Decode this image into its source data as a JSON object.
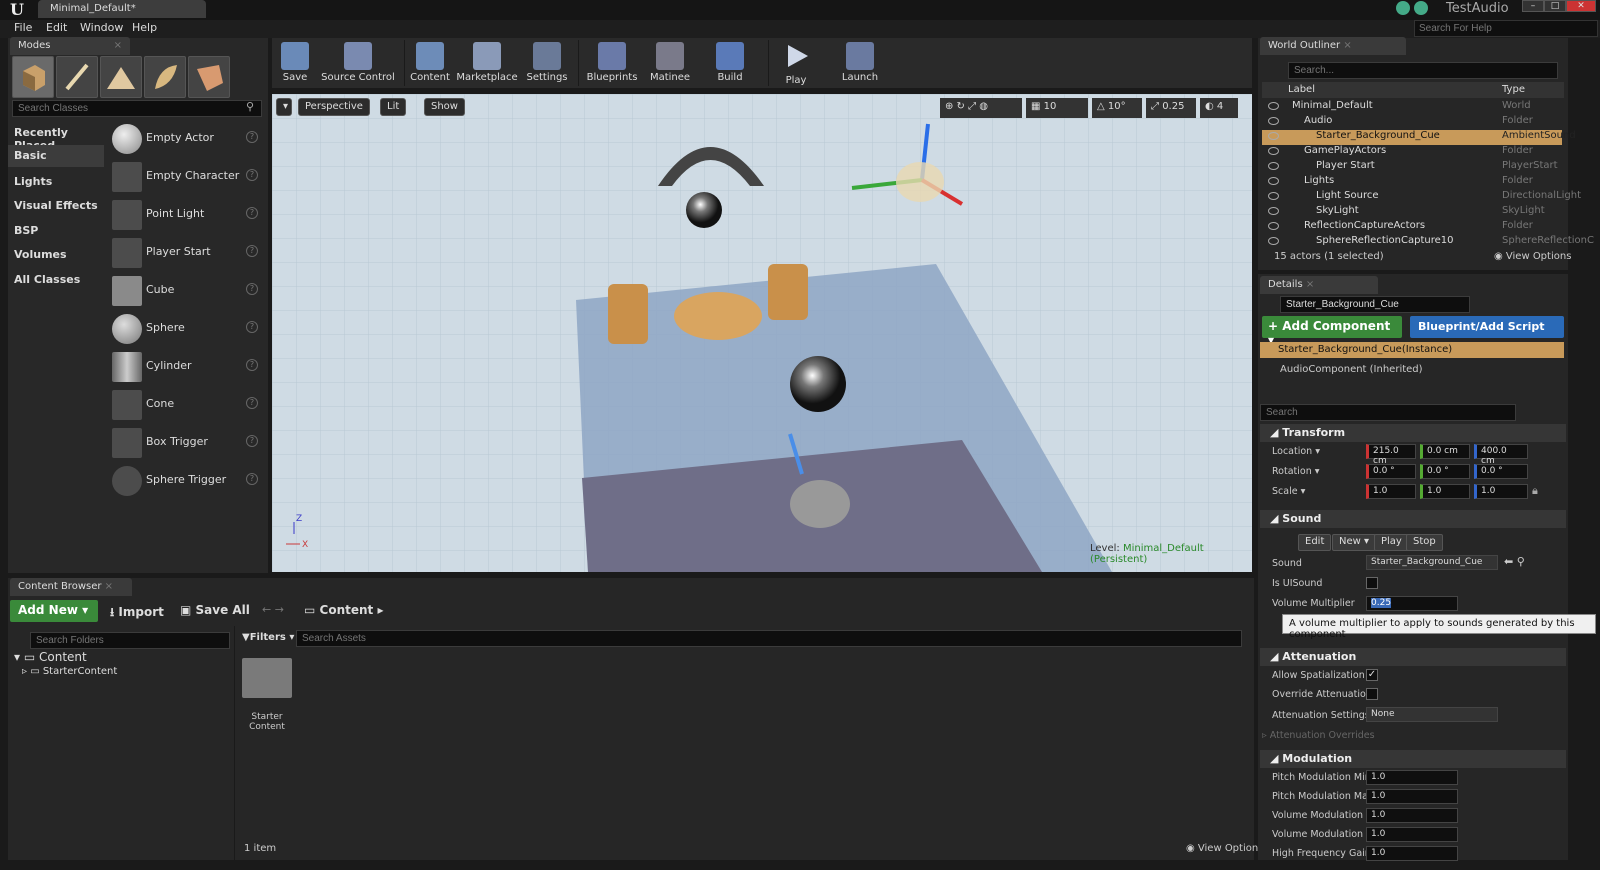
{
  "window": {
    "tab_title": "Minimal_Default*",
    "project_name": "TestAudio",
    "help_search_placeholder": "Search For Help"
  },
  "menu": [
    "File",
    "Edit",
    "Window",
    "Help"
  ],
  "modes": {
    "tab": "Modes",
    "search_placeholder": "Search Classes",
    "categories": [
      "Recently Placed",
      "Basic",
      "Lights",
      "Visual Effects",
      "BSP",
      "Volumes",
      "All Classes"
    ],
    "items": [
      "Empty Actor",
      "Empty Character",
      "Point Light",
      "Player Start",
      "Cube",
      "Sphere",
      "Cylinder",
      "Cone",
      "Box Trigger",
      "Sphere Trigger"
    ]
  },
  "toolbar": [
    "Save",
    "Source Control",
    "Content",
    "Marketplace",
    "Settings",
    "Blueprints",
    "Matinee",
    "Build",
    "Play",
    "Launch"
  ],
  "viewport": {
    "perspective": "Perspective",
    "lit": "Lit",
    "show": "Show",
    "grid_snap": "10",
    "rot_snap": "10°",
    "scale_snap": "0.25",
    "camera_speed": "4",
    "level_label": "Level:",
    "level_name": "Minimal_Default (Persistent)",
    "axis_z": "Z",
    "axis_x": "X"
  },
  "content_browser": {
    "tab": "Content Browser",
    "add_new": "Add New",
    "import": "Import",
    "save_all": "Save All",
    "path": "Content",
    "search_folders": "Search Folders",
    "filters": "Filters",
    "search_assets": "Search Assets",
    "tree_root": "Content",
    "tree_child": "StarterContent",
    "asset_line1": "Starter",
    "asset_line2": "Content",
    "count": "1 item",
    "view_options": "View Options"
  },
  "world_outliner": {
    "tab": "World Outliner",
    "search_placeholder": "Search...",
    "col_label": "Label",
    "col_type": "Type",
    "rows": [
      {
        "label": "Minimal_Default",
        "type": "World"
      },
      {
        "label": "Audio",
        "type": "Folder"
      },
      {
        "label": "Starter_Background_Cue",
        "type": "AmbientSound"
      },
      {
        "label": "GamePlayActors",
        "type": "Folder"
      },
      {
        "label": "Player Start",
        "type": "PlayerStart"
      },
      {
        "label": "Lights",
        "type": "Folder"
      },
      {
        "label": "Light Source",
        "type": "DirectionalLight"
      },
      {
        "label": "SkyLight",
        "type": "SkyLight"
      },
      {
        "label": "ReflectionCaptureActors",
        "type": "Folder"
      },
      {
        "label": "SphereReflectionCapture10",
        "type": "SphereReflectionC"
      }
    ],
    "summary": "15 actors (1 selected)",
    "view_options": "View Options"
  },
  "details": {
    "tab": "Details",
    "name": "Starter_Background_Cue",
    "add_component": "+ Add Component",
    "blueprint": "Blueprint/Add Script",
    "instance": "Starter_Background_Cue(Instance)",
    "component": "AudioComponent (Inherited)",
    "search": "Search",
    "transform": "Transform",
    "location": "Location",
    "rotation": "Rotation",
    "scale": "Scale",
    "loc": [
      "215.0 cm",
      "0.0 cm",
      "400.0 cm"
    ],
    "rot": [
      "0.0 °",
      "0.0 °",
      "0.0 °"
    ],
    "scl": [
      "1.0",
      "1.0",
      "1.0"
    ],
    "sound_section": "Sound",
    "edit": "Edit",
    "new": "New",
    "play": "Play",
    "stop": "Stop",
    "sound_label": "Sound",
    "sound_value": "Starter_Background_Cue",
    "is_ui_sound": "Is UISound",
    "volume_multiplier": "Volume Multiplier",
    "volume_value": "0.25",
    "tooltip": "A volume multiplier to apply to sounds generated by this component",
    "attenuation": "Attenuation",
    "allow_spatialization": "Allow Spatialization",
    "override_attenuation": "Override Attenuation",
    "attenuation_settings": "Attenuation Settings",
    "attenuation_value": "None",
    "attenuation_overrides": "Attenuation Overrides",
    "modulation": "Modulation",
    "mod_rows": [
      {
        "label": "Pitch Modulation Min",
        "value": "1.0"
      },
      {
        "label": "Pitch Modulation Max",
        "value": "1.0"
      },
      {
        "label": "Volume Modulation M",
        "value": "1.0"
      },
      {
        "label": "Volume Modulation M",
        "value": "1.0"
      },
      {
        "label": "High Frequency Gain I",
        "value": "1.0"
      }
    ]
  }
}
